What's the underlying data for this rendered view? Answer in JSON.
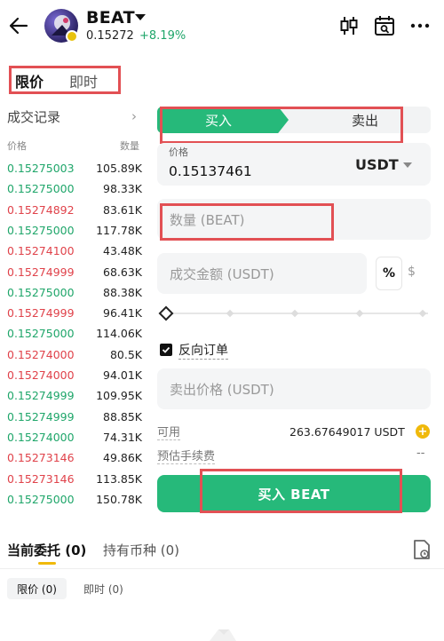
{
  "header": {
    "pair": "BEAT",
    "price": "0.15272",
    "change": "+8.19%"
  },
  "order_type_tabs": [
    "限价",
    "即时"
  ],
  "trades": {
    "title": "成交记录",
    "col_price": "价格",
    "col_qty": "数量",
    "rows": [
      {
        "price": "0.15275003",
        "qty": "105.89K",
        "side": "buy"
      },
      {
        "price": "0.15275000",
        "qty": "98.33K",
        "side": "buy"
      },
      {
        "price": "0.15274892",
        "qty": "83.61K",
        "side": "sell"
      },
      {
        "price": "0.15275000",
        "qty": "117.78K",
        "side": "buy"
      },
      {
        "price": "0.15274100",
        "qty": "43.48K",
        "side": "sell"
      },
      {
        "price": "0.15274999",
        "qty": "68.63K",
        "side": "sell"
      },
      {
        "price": "0.15275000",
        "qty": "88.38K",
        "side": "buy"
      },
      {
        "price": "0.15274999",
        "qty": "96.41K",
        "side": "sell"
      },
      {
        "price": "0.15275000",
        "qty": "114.06K",
        "side": "buy"
      },
      {
        "price": "0.15274000",
        "qty": "80.5K",
        "side": "sell"
      },
      {
        "price": "0.15274000",
        "qty": "94.01K",
        "side": "sell"
      },
      {
        "price": "0.15274999",
        "qty": "109.95K",
        "side": "buy"
      },
      {
        "price": "0.15274999",
        "qty": "88.85K",
        "side": "buy"
      },
      {
        "price": "0.15274000",
        "qty": "74.31K",
        "side": "buy"
      },
      {
        "price": "0.15273146",
        "qty": "49.86K",
        "side": "sell"
      },
      {
        "price": "0.15273146",
        "qty": "113.85K",
        "side": "sell"
      },
      {
        "price": "0.15275000",
        "qty": "150.78K",
        "side": "buy"
      }
    ]
  },
  "form": {
    "buy_tab": "买入",
    "sell_tab": "卖出",
    "price_label": "价格",
    "price_value": "0.15137461",
    "currency": "USDT",
    "qty_placeholder": "数量 (BEAT)",
    "amount_placeholder": "成交金额 (USDT)",
    "pct_button": "%",
    "dollar_button": "$",
    "reverse_order_label": "反向订单",
    "reverse_order_checked": true,
    "sell_price_placeholder": "卖出价格 (USDT)",
    "available_label": "可用",
    "available_value": "263.67649017 USDT",
    "fee_label": "预估手续费",
    "fee_value": "--",
    "submit_label": "买入 BEAT"
  },
  "bottom": {
    "tab_open_orders": "当前委托 (0)",
    "tab_holdings": "持有币种 (0)",
    "sub_limit": "限价 (0)",
    "sub_market": "即时 (0)"
  },
  "colors": {
    "buy_green": "#26b97a",
    "price_up_green": "#1fa66a",
    "price_down_red": "#e0424a",
    "annotation_red": "#e25054",
    "accent_yellow": "#f0b90b"
  }
}
